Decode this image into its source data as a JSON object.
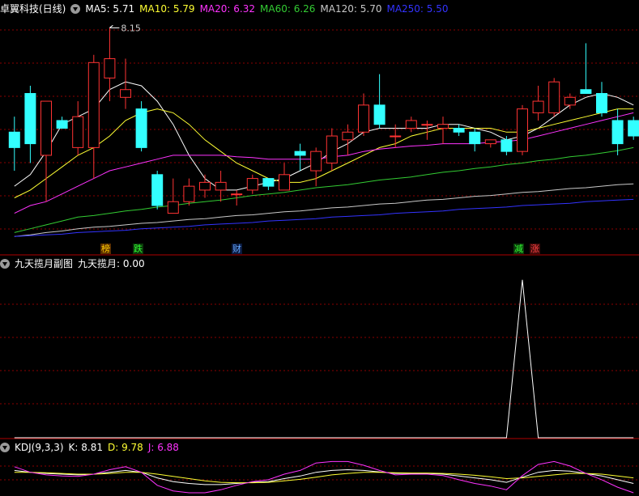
{
  "main_header": {
    "title": "卓翼科技(日线)",
    "ma_labels": [
      {
        "text": "MA5: 5.71",
        "color": "#ffffff"
      },
      {
        "text": "MA10: 5.79",
        "color": "#ffff33"
      },
      {
        "text": "MA20: 6.32",
        "color": "#ff33ff"
      },
      {
        "text": "MA60: 6.26",
        "color": "#33cc33"
      },
      {
        "text": "MA120: 5.70",
        "color": "#c8c8c8"
      },
      {
        "text": "MA250: 5.50",
        "color": "#3333ff"
      }
    ]
  },
  "peak_label": "8.15",
  "tags": [
    {
      "text": "榜",
      "color": "#ffcc00",
      "bg": "#5a2e00"
    },
    {
      "text": "跌",
      "color": "#33ff33",
      "bg": "#0a3a0a"
    },
    {
      "text": "财",
      "color": "#66aaff",
      "bg": "#0a1a40"
    },
    {
      "text": "减",
      "color": "#33ff33",
      "bg": "#0a3a0a"
    },
    {
      "text": "涨",
      "color": "#ff4444",
      "bg": "#400a0a"
    }
  ],
  "sub1_header": {
    "title": "九天揽月副图",
    "value_label": "九天揽月: 0.00"
  },
  "sub2_header": {
    "title": "KDJ(9,3,3)",
    "labels": [
      {
        "text": "K: 8.81",
        "color": "#ffffff"
      },
      {
        "text": "D: 9.78",
        "color": "#ffff33"
      },
      {
        "text": "J: 6.88",
        "color": "#ff33ff"
      }
    ]
  },
  "colors": {
    "up": "#ff3333",
    "down": "#33ffff",
    "grid": "#8b0000",
    "bg": "#000000"
  },
  "chart_data": [
    {
      "type": "candlestick",
      "title": "卓翼科技(日线)",
      "x": [
        1,
        2,
        3,
        4,
        5,
        6,
        7,
        8,
        9,
        10,
        11,
        12,
        13,
        14,
        15,
        16,
        17,
        18,
        19,
        20,
        21,
        22,
        23,
        24,
        25,
        26,
        27,
        28,
        29,
        30,
        31,
        32,
        33,
        34,
        35,
        36,
        37,
        38,
        39,
        40
      ],
      "candles": [
        {
          "o": 6.8,
          "h": 7.0,
          "l": 6.3,
          "c": 6.6
        },
        {
          "o": 7.3,
          "h": 7.4,
          "l": 6.4,
          "c": 6.65
        },
        {
          "o": 6.5,
          "h": 6.65,
          "l": 5.9,
          "c": 7.2
        },
        {
          "o": 6.95,
          "h": 7.0,
          "l": 6.85,
          "c": 6.85
        },
        {
          "o": 6.6,
          "h": 7.2,
          "l": 6.5,
          "c": 7.0
        },
        {
          "o": 6.6,
          "h": 7.8,
          "l": 6.2,
          "c": 7.7
        },
        {
          "o": 7.5,
          "h": 8.15,
          "l": 7.2,
          "c": 7.75
        },
        {
          "o": 7.25,
          "h": 7.75,
          "l": 7.1,
          "c": 7.35
        },
        {
          "o": 7.1,
          "h": 7.2,
          "l": 6.55,
          "c": 6.6
        },
        {
          "o": 6.25,
          "h": 6.3,
          "l": 5.8,
          "c": 5.85
        },
        {
          "o": 5.75,
          "h": 6.2,
          "l": 5.75,
          "c": 5.9
        },
        {
          "o": 5.9,
          "h": 6.2,
          "l": 5.85,
          "c": 6.1
        },
        {
          "o": 6.05,
          "h": 6.25,
          "l": 5.95,
          "c": 6.15
        },
        {
          "o": 6.05,
          "h": 6.3,
          "l": 5.9,
          "c": 6.15
        },
        {
          "o": 6.0,
          "h": 6.05,
          "l": 5.85,
          "c": 6.0
        },
        {
          "o": 6.05,
          "h": 6.25,
          "l": 6.0,
          "c": 6.2
        },
        {
          "o": 6.2,
          "h": 6.2,
          "l": 6.05,
          "c": 6.1
        },
        {
          "o": 6.05,
          "h": 6.4,
          "l": 6.05,
          "c": 6.25
        },
        {
          "o": 6.55,
          "h": 6.65,
          "l": 6.3,
          "c": 6.5
        },
        {
          "o": 6.3,
          "h": 6.6,
          "l": 6.1,
          "c": 6.55
        },
        {
          "o": 6.4,
          "h": 6.85,
          "l": 6.3,
          "c": 6.75
        },
        {
          "o": 6.7,
          "h": 6.9,
          "l": 6.5,
          "c": 6.8
        },
        {
          "o": 6.8,
          "h": 7.3,
          "l": 6.75,
          "c": 7.15
        },
        {
          "o": 7.15,
          "h": 7.55,
          "l": 6.85,
          "c": 6.9
        },
        {
          "o": 6.75,
          "h": 6.9,
          "l": 6.6,
          "c": 6.75
        },
        {
          "o": 6.85,
          "h": 7.0,
          "l": 6.8,
          "c": 6.95
        },
        {
          "o": 6.9,
          "h": 6.95,
          "l": 6.7,
          "c": 6.9
        },
        {
          "o": 6.85,
          "h": 7.0,
          "l": 6.65,
          "c": 6.9
        },
        {
          "o": 6.85,
          "h": 6.9,
          "l": 6.75,
          "c": 6.8
        },
        {
          "o": 6.8,
          "h": 6.85,
          "l": 6.55,
          "c": 6.65
        },
        {
          "o": 6.65,
          "h": 6.7,
          "l": 6.6,
          "c": 6.7
        },
        {
          "o": 6.7,
          "h": 6.75,
          "l": 6.5,
          "c": 6.55
        },
        {
          "o": 6.55,
          "h": 7.15,
          "l": 6.5,
          "c": 7.1
        },
        {
          "o": 7.05,
          "h": 7.4,
          "l": 6.95,
          "c": 7.2
        },
        {
          "o": 7.05,
          "h": 7.5,
          "l": 7.0,
          "c": 7.45
        },
        {
          "o": 7.15,
          "h": 7.3,
          "l": 7.1,
          "c": 7.25
        },
        {
          "o": 7.35,
          "h": 7.95,
          "l": 7.3,
          "c": 7.3
        },
        {
          "o": 7.3,
          "h": 7.45,
          "l": 7.0,
          "c": 7.05
        },
        {
          "o": 6.95,
          "h": 7.1,
          "l": 6.5,
          "c": 6.65
        },
        {
          "o": 6.95,
          "h": 7.0,
          "l": 6.7,
          "c": 6.75
        }
      ],
      "series": [
        {
          "name": "MA5",
          "color": "#ffffff",
          "values": [
            6.1,
            6.25,
            6.55,
            6.9,
            7.0,
            7.1,
            7.35,
            7.45,
            7.4,
            7.2,
            6.9,
            6.5,
            6.2,
            6.05,
            6.05,
            6.1,
            6.15,
            6.2,
            6.3,
            6.4,
            6.55,
            6.65,
            6.8,
            6.85,
            6.85,
            6.85,
            6.85,
            6.9,
            6.9,
            6.85,
            6.8,
            6.7,
            6.75,
            6.85,
            7.0,
            7.15,
            7.25,
            7.3,
            7.25,
            7.15
          ]
        },
        {
          "name": "MA10",
          "color": "#ffff33",
          "values": [
            5.95,
            6.05,
            6.2,
            6.35,
            6.5,
            6.6,
            6.75,
            6.95,
            7.05,
            7.1,
            7.05,
            6.9,
            6.7,
            6.55,
            6.4,
            6.3,
            6.2,
            6.15,
            6.15,
            6.2,
            6.3,
            6.4,
            6.5,
            6.6,
            6.65,
            6.75,
            6.8,
            6.85,
            6.85,
            6.85,
            6.85,
            6.8,
            6.8,
            6.85,
            6.9,
            6.95,
            7.0,
            7.05,
            7.1,
            7.1
          ]
        },
        {
          "name": "MA20",
          "color": "#ff33ff",
          "values": [
            5.75,
            5.85,
            5.9,
            6.0,
            6.1,
            6.2,
            6.3,
            6.35,
            6.4,
            6.45,
            6.5,
            6.5,
            6.5,
            6.5,
            6.48,
            6.47,
            6.45,
            6.45,
            6.45,
            6.45,
            6.48,
            6.5,
            6.55,
            6.58,
            6.6,
            6.62,
            6.63,
            6.65,
            6.65,
            6.65,
            6.67,
            6.68,
            6.7,
            6.75,
            6.8,
            6.85,
            6.9,
            6.95,
            7.0,
            7.05
          ]
        }
      ],
      "extra_series": [
        {
          "name": "MA60",
          "color": "#33cc33",
          "values": [
            5.5,
            5.55,
            5.6,
            5.65,
            5.7,
            5.72,
            5.75,
            5.78,
            5.8,
            5.83,
            5.85,
            5.88,
            5.9,
            5.92,
            5.95,
            5.98,
            6.0,
            6.02,
            6.05,
            6.08,
            6.1,
            6.12,
            6.15,
            6.18,
            6.2,
            6.22,
            6.25,
            6.28,
            6.3,
            6.33,
            6.35,
            6.38,
            6.4,
            6.43,
            6.45,
            6.48,
            6.5,
            6.53,
            6.56,
            6.6
          ]
        },
        {
          "name": "MA120",
          "color": "#c8c8c8",
          "values": [
            5.45,
            5.47,
            5.5,
            5.52,
            5.55,
            5.57,
            5.58,
            5.6,
            5.62,
            5.63,
            5.65,
            5.67,
            5.68,
            5.7,
            5.72,
            5.73,
            5.75,
            5.77,
            5.78,
            5.8,
            5.82,
            5.83,
            5.85,
            5.87,
            5.88,
            5.9,
            5.92,
            5.93,
            5.95,
            5.97,
            5.98,
            6.0,
            6.02,
            6.03,
            6.05,
            6.07,
            6.08,
            6.1,
            6.12,
            6.13
          ]
        },
        {
          "name": "MA250",
          "color": "#3333ff",
          "values": [
            5.45,
            5.46,
            5.47,
            5.48,
            5.5,
            5.51,
            5.52,
            5.53,
            5.55,
            5.56,
            5.57,
            5.58,
            5.6,
            5.61,
            5.62,
            5.63,
            5.65,
            5.66,
            5.67,
            5.68,
            5.7,
            5.71,
            5.72,
            5.73,
            5.75,
            5.76,
            5.77,
            5.78,
            5.8,
            5.81,
            5.82,
            5.83,
            5.85,
            5.86,
            5.87,
            5.88,
            5.9,
            5.91,
            5.92,
            5.93
          ]
        }
      ],
      "ylim": [
        5.4,
        8.3
      ]
    },
    {
      "type": "line",
      "title": "九天揽月副图",
      "x": [
        1,
        2,
        3,
        4,
        5,
        6,
        7,
        8,
        9,
        10,
        11,
        12,
        13,
        14,
        15,
        16,
        17,
        18,
        19,
        20,
        21,
        22,
        23,
        24,
        25,
        26,
        27,
        28,
        29,
        30,
        31,
        32,
        33,
        34,
        35,
        36,
        37,
        38,
        39,
        40
      ],
      "series": [
        {
          "name": "九天揽月",
          "color": "#ffffff",
          "values": [
            0,
            0,
            0,
            0,
            0,
            0,
            0,
            0,
            0,
            0,
            0,
            0,
            0,
            0,
            0,
            0,
            0,
            0,
            0,
            0,
            0,
            0,
            0,
            0,
            0,
            0,
            0,
            0,
            0,
            0,
            0,
            0,
            1,
            0,
            0,
            0,
            0,
            0,
            0,
            0
          ]
        }
      ],
      "ylim": [
        0,
        1.05
      ]
    },
    {
      "type": "line",
      "title": "KDJ(9,3,3)",
      "x": [
        1,
        2,
        3,
        4,
        5,
        6,
        7,
        8,
        9,
        10,
        11,
        12,
        13,
        14,
        15,
        16,
        17,
        18,
        19,
        20,
        21,
        22,
        23,
        24,
        25,
        26,
        27,
        28,
        29,
        30,
        31,
        32,
        33,
        34,
        35,
        36,
        37,
        38,
        39,
        40
      ],
      "series": [
        {
          "name": "K",
          "color": "#ffffff",
          "values": [
            60,
            55,
            52,
            50,
            48,
            50,
            55,
            60,
            55,
            40,
            30,
            25,
            22,
            22,
            25,
            28,
            30,
            38,
            45,
            55,
            60,
            62,
            60,
            56,
            52,
            52,
            52,
            50,
            45,
            40,
            35,
            28,
            42,
            55,
            60,
            58,
            52,
            45,
            35,
            25
          ]
        },
        {
          "name": "D",
          "color": "#ffff33",
          "values": [
            55,
            55,
            54,
            52,
            50,
            50,
            52,
            55,
            55,
            50,
            44,
            38,
            32,
            28,
            27,
            27,
            28,
            32,
            36,
            42,
            48,
            52,
            55,
            55,
            54,
            53,
            53,
            52,
            50,
            47,
            43,
            38,
            40,
            44,
            48,
            52,
            52,
            50,
            45,
            40
          ]
        },
        {
          "name": "J",
          "color": "#ff33ff",
          "values": [
            70,
            55,
            48,
            45,
            44,
            50,
            62,
            70,
            55,
            20,
            5,
            0,
            0,
            8,
            20,
            30,
            35,
            50,
            60,
            80,
            84,
            84,
            74,
            60,
            48,
            50,
            50,
            46,
            35,
            25,
            18,
            8,
            46,
            76,
            84,
            72,
            52,
            35,
            15,
            0
          ]
        }
      ],
      "ylim": [
        0,
        100
      ]
    }
  ]
}
